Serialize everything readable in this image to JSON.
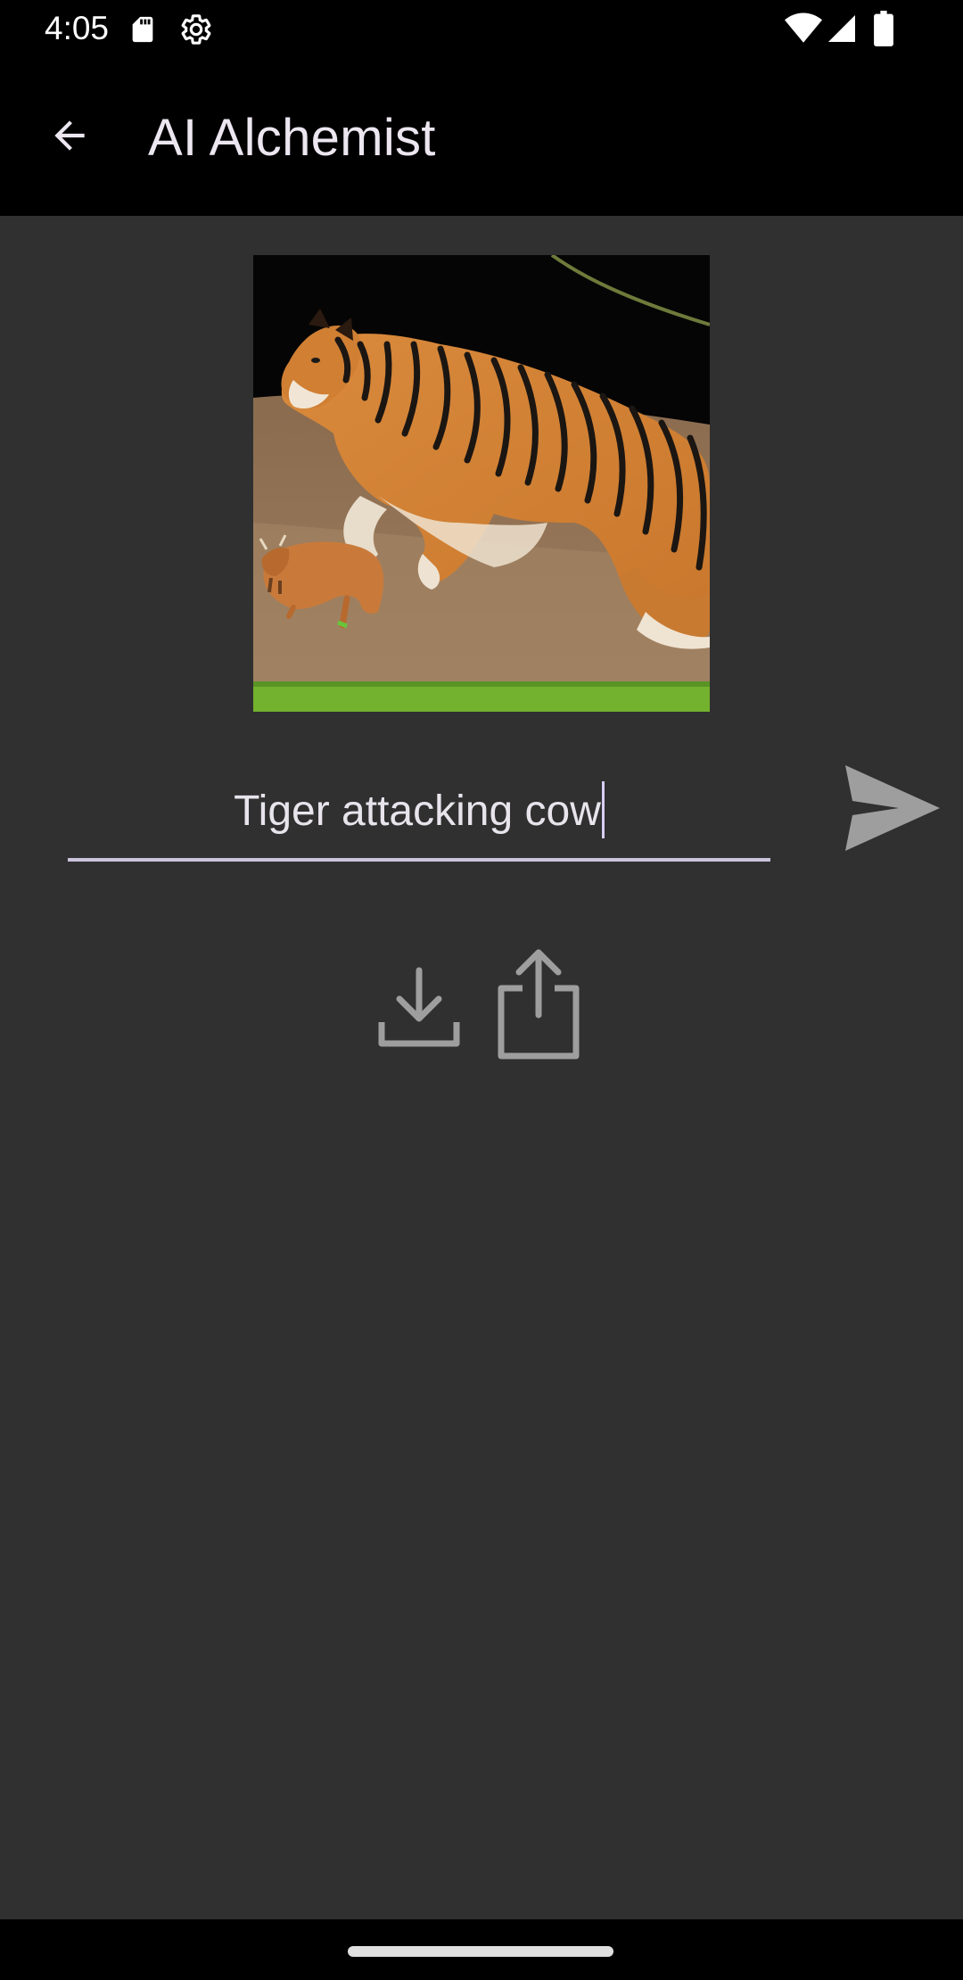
{
  "status_bar": {
    "time": "4:05",
    "left_icons": [
      "sd-card-icon",
      "settings-gear-icon"
    ],
    "right_icons": [
      "wifi-icon",
      "cellular-signal-icon",
      "battery-icon"
    ]
  },
  "app_bar": {
    "back_icon": "arrow-back-icon",
    "title": "AI Alchemist"
  },
  "main": {
    "generated_image": {
      "icon": "generated-image"
    },
    "prompt": {
      "value": "Tiger attacking cow",
      "placeholder": ""
    },
    "send_icon": "send-icon",
    "actions": [
      {
        "icon": "download-icon"
      },
      {
        "icon": "share-icon"
      }
    ]
  },
  "colors": {
    "background": "#303030",
    "app_bar": "#000000",
    "title_text": "#ece6f0",
    "underline": "#cbc2dc",
    "icon_gray": "#9e9e9e"
  }
}
